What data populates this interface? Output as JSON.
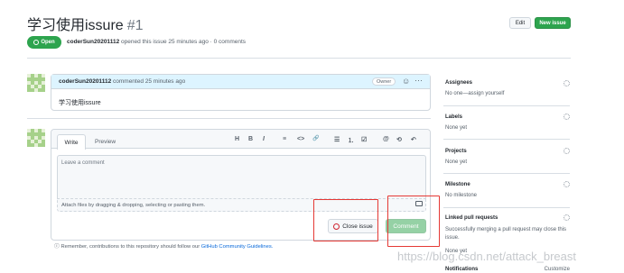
{
  "header": {
    "title": "学习使用issure",
    "number": "#1",
    "edit_label": "Edit",
    "new_issue_label": "New issue"
  },
  "status": {
    "badge": "Open",
    "author": "coderSun20201112",
    "meta_text": "opened this issue 25 minutes ago · 0 comments"
  },
  "comment": {
    "author": "coderSun20201112",
    "meta": "commented 25 minutes ago",
    "role": "Owner",
    "body": "学习使用issure"
  },
  "editor": {
    "tabs": [
      "Write",
      "Preview"
    ],
    "placeholder": "Leave a comment",
    "attach_text": "Attach files by dragging & dropping, selecting or pasting them.",
    "close_label": "Close issue",
    "comment_label": "Comment",
    "toolbar": [
      "H",
      "B",
      "I",
      "quote",
      "code",
      "link",
      "ul",
      "ol",
      "task",
      "mention",
      "reference",
      "reply"
    ],
    "toolbar_glyphs": [
      "H",
      "B",
      "I",
      "≡",
      "<>",
      "🔗",
      "☰",
      "⒈",
      "☑",
      "@",
      "⟲",
      "↶"
    ],
    "footer_note": "Remember, contributions to this repository should follow our",
    "footer_link": "GitHub Community Guidelines."
  },
  "sidebar": {
    "sections": [
      {
        "title": "Assignees",
        "value": "No one—assign yourself"
      },
      {
        "title": "Labels",
        "value": "None yet"
      },
      {
        "title": "Projects",
        "value": "None yet"
      },
      {
        "title": "Milestone",
        "value": "No milestone"
      },
      {
        "title": "Linked pull requests",
        "value": "Successfully merging a pull request may close this issue."
      },
      {
        "title": "",
        "value": "None yet"
      }
    ],
    "notifications": "Notifications",
    "customize": "Customize"
  },
  "watermark": "https://blog.csdn.net/attack_breast",
  "colors": {
    "green": "#2da44e",
    "highlight": "#e53935",
    "comment_head": "#ddf4ff"
  }
}
